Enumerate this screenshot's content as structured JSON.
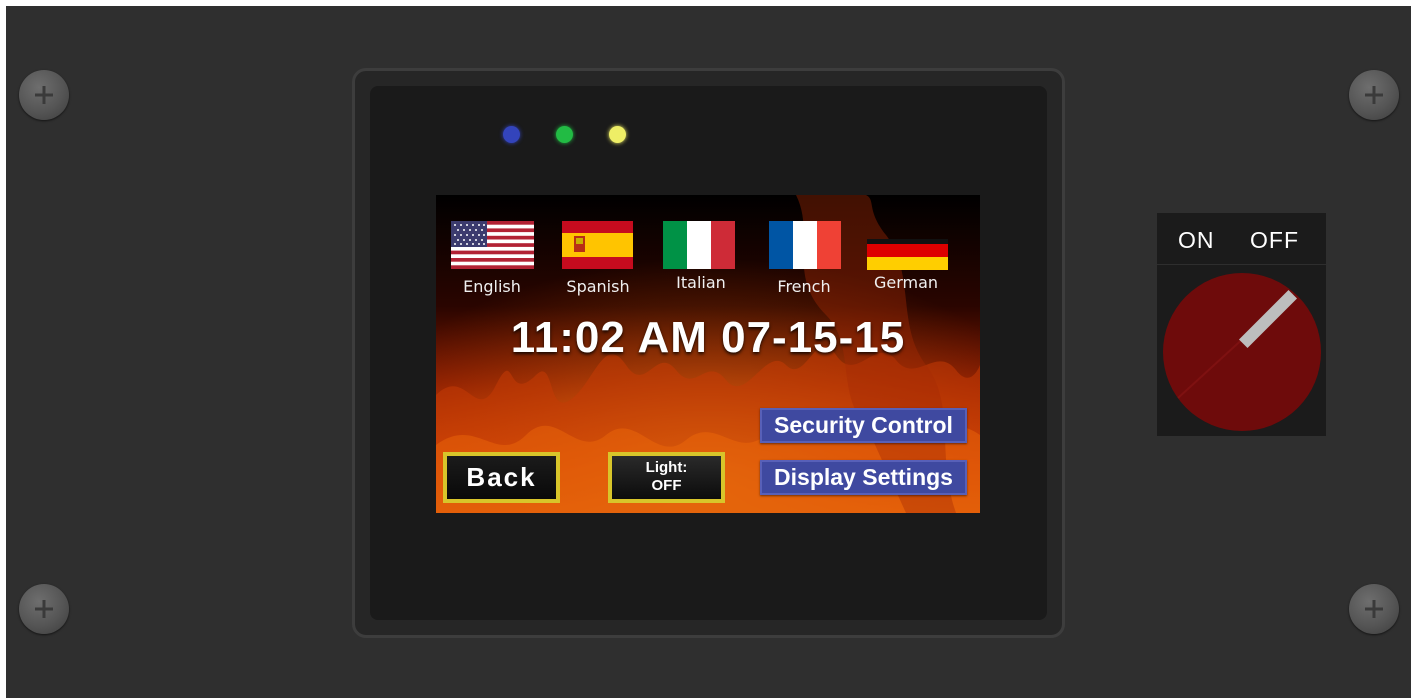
{
  "leds": [
    {
      "name": "blue",
      "color": "#3344bb"
    },
    {
      "name": "green",
      "color": "#22bb44"
    },
    {
      "name": "yellow",
      "color": "#eeee66"
    }
  ],
  "languages": [
    {
      "label": "English",
      "flag": "us-flag"
    },
    {
      "label": "Spanish",
      "flag": "spain-flag"
    },
    {
      "label": "Italian",
      "flag": "italy-flag"
    },
    {
      "label": "French",
      "flag": "france-flag"
    },
    {
      "label": "German",
      "flag": "germany-flag"
    }
  ],
  "clock": {
    "text": "11:02 AM 07-15-15"
  },
  "buttons": {
    "back": "Back",
    "light_line1": "Light:",
    "light_line2": "OFF",
    "security": "Security Control",
    "display": "Display Settings"
  },
  "power_switch": {
    "on_label": "ON",
    "off_label": "OFF",
    "knob_color": "#6e0b0b"
  },
  "colors": {
    "panel": "#2f2f2f",
    "button_blue": "#3f49a0",
    "button_border_yellow": "#d8c52a"
  }
}
